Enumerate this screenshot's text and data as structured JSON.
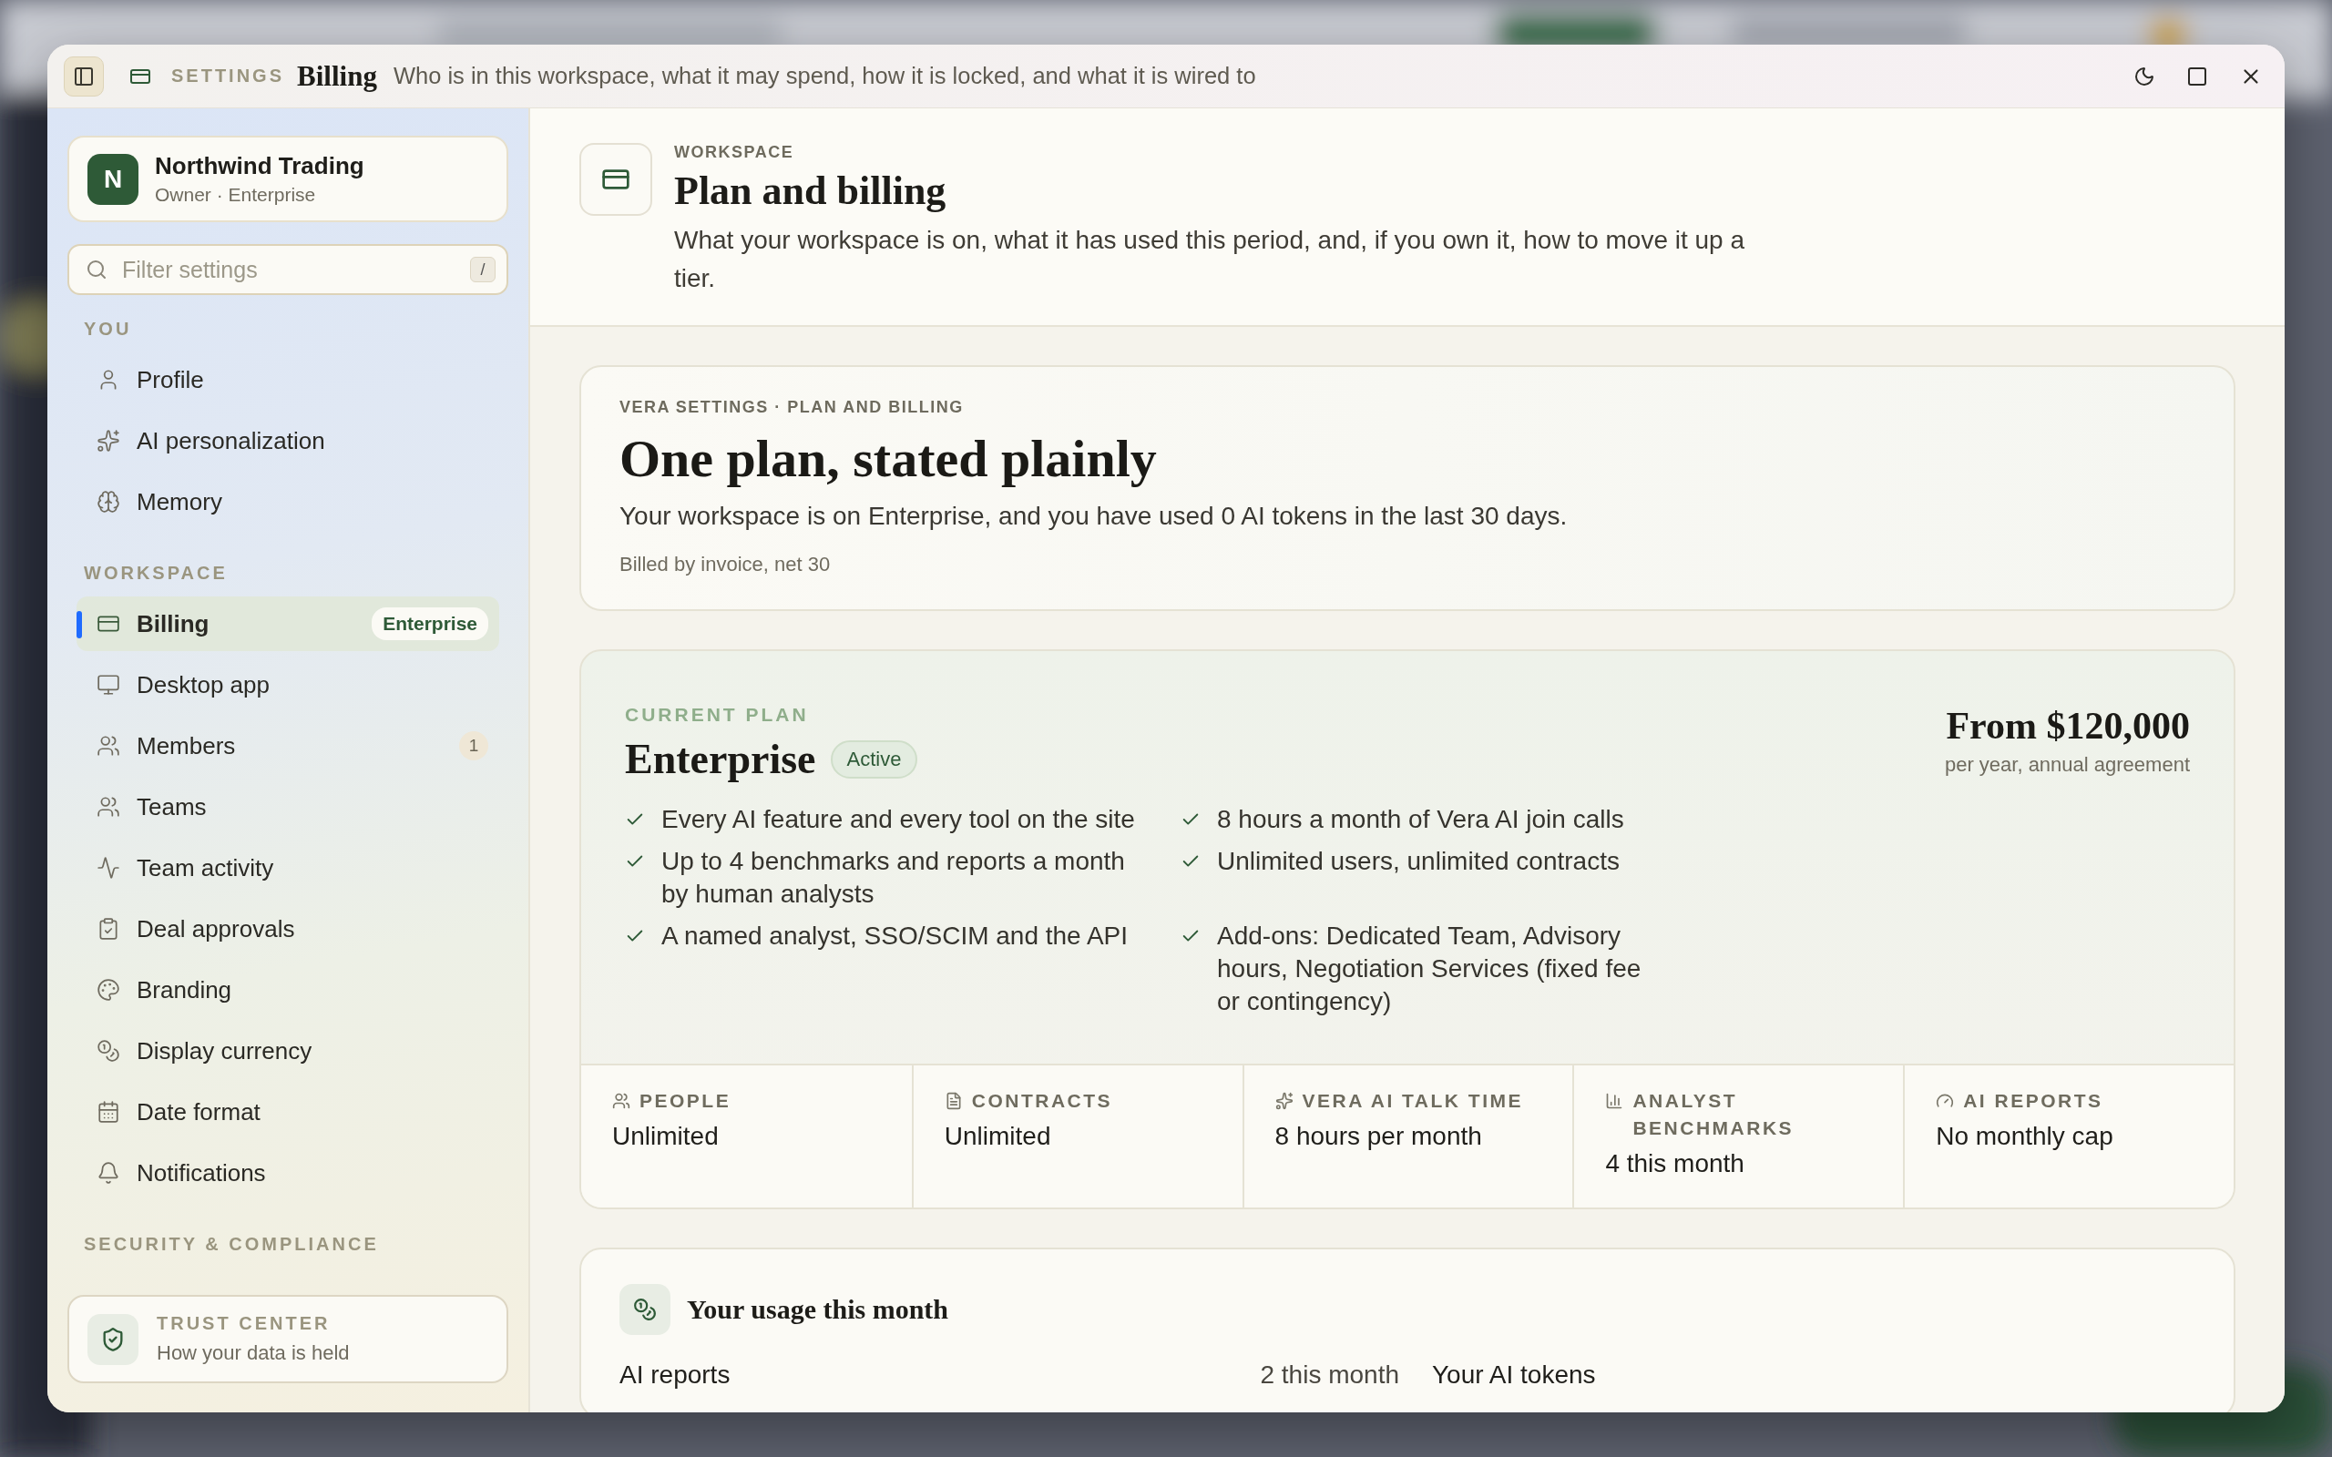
{
  "titlebar": {
    "section": "SETTINGS",
    "title": "Billing",
    "subtitle": "Who is in this workspace, what it may spend, how it is locked, and what it is wired to"
  },
  "sidebar": {
    "account": {
      "initial": "N",
      "name": "Northwind Trading",
      "role": "Owner · Enterprise"
    },
    "search": {
      "placeholder": "Filter settings",
      "shortcut": "/"
    },
    "groups": [
      {
        "label": "YOU",
        "items": [
          {
            "label": "Profile",
            "selected": false
          },
          {
            "label": "AI personalization",
            "selected": false
          },
          {
            "label": "Memory",
            "selected": false
          }
        ]
      },
      {
        "label": "WORKSPACE",
        "items": [
          {
            "label": "Billing",
            "selected": true,
            "badge": "Enterprise"
          },
          {
            "label": "Desktop app",
            "selected": false
          },
          {
            "label": "Members",
            "selected": false,
            "count": "1"
          },
          {
            "label": "Teams",
            "selected": false
          },
          {
            "label": "Team activity",
            "selected": false
          },
          {
            "label": "Deal approvals",
            "selected": false
          },
          {
            "label": "Branding",
            "selected": false
          },
          {
            "label": "Display currency",
            "selected": false
          },
          {
            "label": "Date format",
            "selected": false
          },
          {
            "label": "Notifications",
            "selected": false
          }
        ]
      },
      {
        "label": "SECURITY & COMPLIANCE"
      }
    ],
    "trust": {
      "label": "TRUST CENTER",
      "text": "How your data is held"
    }
  },
  "header": {
    "eyebrow": "WORKSPACE",
    "title": "Plan and billing",
    "description": "What your workspace is on, what it has used this period, and, if you own it, how to move it up a tier."
  },
  "summary": {
    "eyebrow": "VERA SETTINGS · PLAN AND BILLING",
    "title": "One plan, stated plainly",
    "text": "Your workspace is on Enterprise, and you have used 0 AI tokens in the last 30 days.",
    "note": "Billed by invoice, net 30"
  },
  "plan": {
    "eyebrow": "CURRENT PLAN",
    "name": "Enterprise",
    "status": "Active",
    "price": "From $120,000",
    "price_note": "per year, annual agreement",
    "features": [
      "Every AI feature and every tool on the site",
      "8 hours a month of Vera AI join calls",
      "Up to 4 benchmarks and reports a month by human analysts",
      "Unlimited users, unlimited contracts",
      "A named analyst, SSO/SCIM and the API",
      "Add-ons: Dedicated Team, Advisory hours, Negotiation Services (fixed fee or contingency)"
    ],
    "stats": [
      {
        "label": "PEOPLE",
        "value": "Unlimited"
      },
      {
        "label": "CONTRACTS",
        "value": "Unlimited"
      },
      {
        "label": "VERA AI TALK TIME",
        "value": "8 hours per month"
      },
      {
        "label": "ANALYST BENCHMARKS",
        "value": "4 this month"
      },
      {
        "label": "AI REPORTS",
        "value": "No monthly cap"
      }
    ]
  },
  "usage": {
    "title": "Your usage this month",
    "columns": [
      {
        "label": "AI reports",
        "value": "2 this month"
      },
      {
        "label": "Your AI tokens"
      }
    ]
  }
}
